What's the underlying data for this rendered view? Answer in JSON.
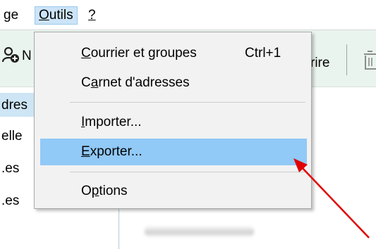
{
  "menubar": {
    "partial_item": "ge",
    "outils": {
      "mnemonic": "O",
      "rest": "utils"
    },
    "help": "?"
  },
  "toolbar": {
    "partial_new_label": "N",
    "partial_write_label": "rire"
  },
  "left_pane": {
    "rows": [
      "dres",
      "elle",
      ".es",
      ".es"
    ]
  },
  "outils_menu": {
    "items": [
      {
        "pre": "",
        "mnemonic": "C",
        "post": "ourrier et groupes",
        "shortcut": "Ctrl+1"
      },
      {
        "pre": "C",
        "mnemonic": "a",
        "post": "rnet d'adresses",
        "shortcut": ""
      },
      {
        "pre": "",
        "mnemonic": "I",
        "post": "mporter...",
        "shortcut": ""
      },
      {
        "pre": "",
        "mnemonic": "E",
        "post": "xporter...",
        "shortcut": ""
      },
      {
        "pre": "O",
        "mnemonic": "p",
        "post": "tions",
        "shortcut": ""
      }
    ],
    "highlighted_index": 3
  },
  "colors": {
    "toolbar_bg": "#eaf4ee",
    "menu_bg": "#f2f2f2",
    "highlight": "#91c9f7",
    "selected_row": "#cde5f4",
    "arrow": "#e00000"
  },
  "icons": [
    "address-book-add-icon",
    "trash-icon",
    "red-arrow-annotation"
  ]
}
